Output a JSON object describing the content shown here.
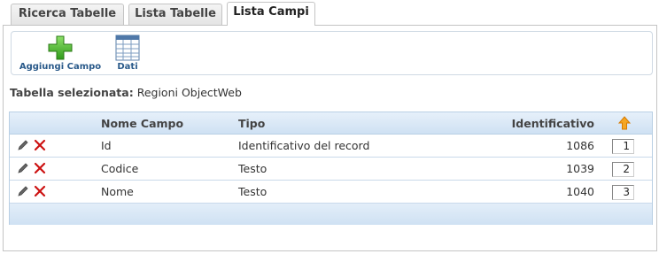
{
  "tabs": [
    {
      "label": "Ricerca Tabelle"
    },
    {
      "label": "Lista Tabelle"
    },
    {
      "label": "Lista Campi"
    }
  ],
  "toolbar": {
    "add_field_label": "Aggiungi Campo",
    "data_label": "Dati"
  },
  "selected_table": {
    "label": "Tabella selezionata:",
    "value": "Regioni ObjectWeb"
  },
  "grid": {
    "headers": {
      "field_name": "Nome Campo",
      "type": "Tipo",
      "identifier": "Identificativo"
    },
    "rows": [
      {
        "name": "Id",
        "type": "Identificativo del record",
        "identifier": "1086",
        "order": "1"
      },
      {
        "name": "Codice",
        "type": "Testo",
        "identifier": "1039",
        "order": "2"
      },
      {
        "name": "Nome",
        "type": "Testo",
        "identifier": "1040",
        "order": "3"
      }
    ]
  },
  "colors": {
    "accent": "#2a5a8a",
    "header_bg": "#cfe1f3",
    "sort_arrow": "#f39c12",
    "delete": "#cc1111",
    "add_green": "#3cb521"
  }
}
